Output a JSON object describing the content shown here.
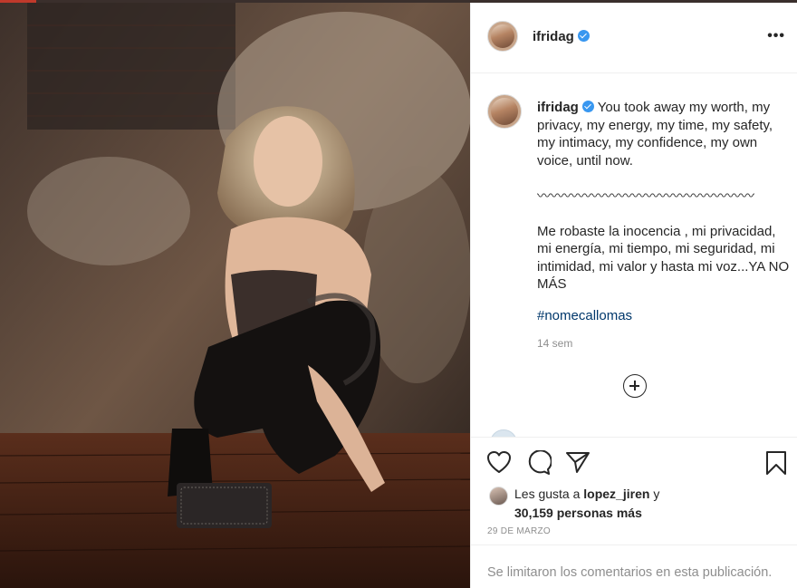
{
  "post": {
    "username": "ifridag",
    "more_icon": "more-horizontal-icon",
    "verified_icon": "verified-badge-icon"
  },
  "caption": {
    "username": "ifridag",
    "text_en": "You took away my worth, my privacy, my energy, my time, my safety, my intimacy, my confidence, my own voice, until now.",
    "divider": "〰〰〰〰〰〰〰〰〰〰〰〰〰〰〰〰",
    "text_es": "Me robaste la inocencia , mi privacidad, mi energía, mi tiempo, mi seguridad, mi intimidad, mi valor y hasta mi voz...YA NO MÁS",
    "hashtag": "#nomecallomas",
    "time_ago": "14 sem"
  },
  "load_more_icon": "plus-circle-icon",
  "actions": {
    "like_icon": "heart-icon",
    "comment_icon": "comment-icon",
    "share_icon": "paper-plane-icon",
    "save_icon": "bookmark-icon"
  },
  "likes": {
    "prefix": "Les gusta a",
    "user": "lopez_jiren",
    "conj": "y",
    "others": "30,159 personas más"
  },
  "post_date": "29 DE MARZO",
  "comments_limited": "Se limitaron los comentarios en esta publicación.",
  "colors": {
    "link": "#00376b",
    "verified": "#3897f0",
    "muted": "#8e8e8e",
    "text": "#262626"
  }
}
